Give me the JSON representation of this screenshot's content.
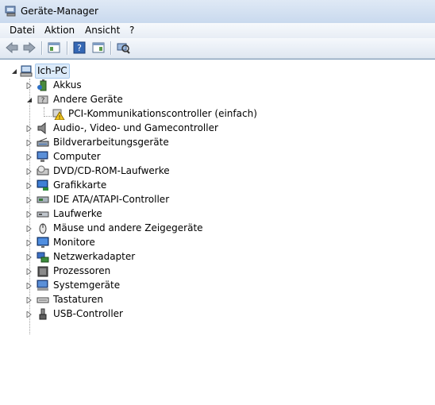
{
  "window": {
    "title": "Geräte-Manager"
  },
  "menu": {
    "datei": "Datei",
    "aktion": "Aktion",
    "ansicht": "Ansicht",
    "help": "?"
  },
  "tree": {
    "root": "Ich-PC",
    "items": [
      {
        "label": "Akkus",
        "icon": "battery-icon",
        "expanded": false
      },
      {
        "label": "Andere Geräte",
        "icon": "unknown-device-icon",
        "expanded": true,
        "children": [
          {
            "label": "PCI-Kommunikationscontroller (einfach)",
            "icon": "warning-device-icon"
          }
        ]
      },
      {
        "label": "Audio-, Video- und Gamecontroller",
        "icon": "speaker-icon",
        "expanded": false
      },
      {
        "label": "Bildverarbeitungsgeräte",
        "icon": "scanner-icon",
        "expanded": false
      },
      {
        "label": "Computer",
        "icon": "computer-icon",
        "expanded": false
      },
      {
        "label": "DVD/CD-ROM-Laufwerke",
        "icon": "dvd-drive-icon",
        "expanded": false
      },
      {
        "label": "Grafikkarte",
        "icon": "graphics-card-icon",
        "expanded": false
      },
      {
        "label": "IDE ATA/ATAPI-Controller",
        "icon": "ide-controller-icon",
        "expanded": false
      },
      {
        "label": "Laufwerke",
        "icon": "disk-drive-icon",
        "expanded": false
      },
      {
        "label": "Mäuse und andere Zeigegeräte",
        "icon": "mouse-icon",
        "expanded": false
      },
      {
        "label": "Monitore",
        "icon": "monitor-icon",
        "expanded": false
      },
      {
        "label": "Netzwerkadapter",
        "icon": "network-adapter-icon",
        "expanded": false
      },
      {
        "label": "Prozessoren",
        "icon": "processor-icon",
        "expanded": false
      },
      {
        "label": "Systemgeräte",
        "icon": "system-device-icon",
        "expanded": false
      },
      {
        "label": "Tastaturen",
        "icon": "keyboard-icon",
        "expanded": false
      },
      {
        "label": "USB-Controller",
        "icon": "usb-icon",
        "expanded": false
      }
    ]
  }
}
